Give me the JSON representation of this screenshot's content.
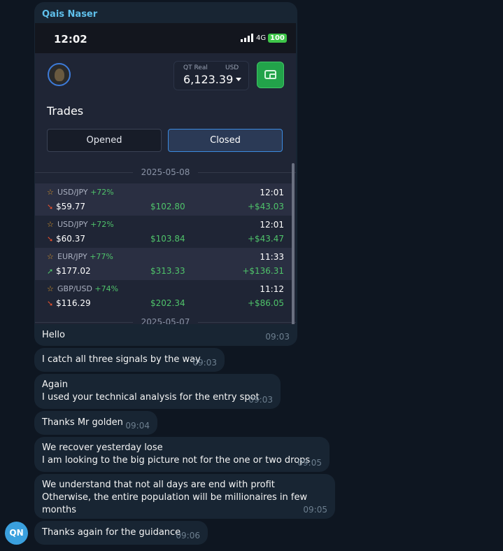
{
  "sender": "Qais Naser",
  "screenshot": {
    "clock": "12:02",
    "network": "4G",
    "battery": "100",
    "account_type": "QT Real",
    "currency": "USD",
    "balance": "6,123.39",
    "title": "Trades",
    "tabs": {
      "opened": "Opened",
      "closed": "Closed"
    },
    "date_1": "2025-05-08",
    "date_2": "2025-05-07",
    "trades": [
      {
        "pair": "USD/JPY",
        "pct": "+72%",
        "time": "12:01",
        "direction": "down",
        "arrow": "➘",
        "stake": "$59.77",
        "payout": "$102.80",
        "profit": "+$43.03"
      },
      {
        "pair": "USD/JPY",
        "pct": "+72%",
        "time": "12:01",
        "direction": "down",
        "arrow": "➘",
        "stake": "$60.37",
        "payout": "$103.84",
        "profit": "+$43.47"
      },
      {
        "pair": "EUR/JPY",
        "pct": "+77%",
        "time": "11:33",
        "direction": "up",
        "arrow": "➚",
        "stake": "$177.02",
        "payout": "$313.33",
        "profit": "+$136.31"
      },
      {
        "pair": "GBP/USD",
        "pct": "+74%",
        "time": "11:12",
        "direction": "down",
        "arrow": "➘",
        "stake": "$116.29",
        "payout": "$202.34",
        "profit": "+$86.05"
      }
    ]
  },
  "messages": [
    {
      "lines": [
        "Hello"
      ],
      "time": "09:03"
    },
    {
      "lines": [
        "I catch all three signals by the way"
      ],
      "time": "09:03"
    },
    {
      "lines": [
        "Again",
        "I used your technical analysis for the entry spot"
      ],
      "time": "09:03"
    },
    {
      "lines": [
        "Thanks Mr golden"
      ],
      "time": "09:04"
    },
    {
      "lines": [
        "We recover yesterday lose",
        "I am looking to the big picture not for the one or two drops"
      ],
      "time": "09:05"
    },
    {
      "lines": [
        "We understand that not all days are end with profit",
        "Otherwise, the entire population will be millionaires in few months"
      ],
      "time": "09:05"
    },
    {
      "lines": [
        "Thanks again for the guidance"
      ],
      "time": "09:06"
    }
  ],
  "avatar_initials": "QN",
  "colors": {
    "background": "#0e1621",
    "bubble": "#182533",
    "sender": "#5fbfea",
    "profit_green": "#4fc36a",
    "loss_red": "#e8502c"
  }
}
